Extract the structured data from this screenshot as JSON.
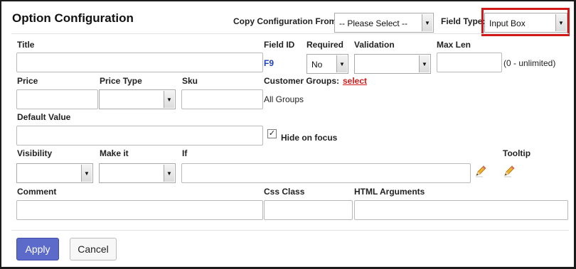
{
  "dialog": {
    "title": "Option Configuration",
    "copy_config_label": "Copy Configuration From:",
    "copy_config_value": "-- Please Select --",
    "field_type_label": "Field Type:",
    "field_type_value": "Input Box"
  },
  "labels": {
    "title": "Title",
    "field_id": "Field ID",
    "required": "Required",
    "validation": "Validation",
    "max_len": "Max Len",
    "price": "Price",
    "price_type": "Price Type",
    "sku": "Sku",
    "customer_groups": "Customer Groups:",
    "default_value": "Default Value",
    "hide_on_focus": "Hide on focus",
    "visibility": "Visibility",
    "make_it": "Make it",
    "if": "If",
    "tooltip": "Tooltip",
    "comment": "Comment",
    "css_class": "Css Class",
    "html_arguments": "HTML Arguments"
  },
  "values": {
    "field_id": "F9",
    "required": "No",
    "validation": "",
    "price_type": "",
    "visibility": "",
    "make_it": "",
    "max_len_hint": "(0 - unlimited)",
    "customer_groups_link": "select",
    "customer_groups_value": "All Groups",
    "hide_on_focus_checked": true
  },
  "buttons": {
    "apply": "Apply",
    "cancel": "Cancel"
  },
  "icons": {
    "if_edit": "pencil-icon",
    "tooltip_edit": "pencil-icon"
  },
  "colors": {
    "apply_bg": "#5c6bc9",
    "link_red": "#d21a1a",
    "field_id_blue": "#1f3fb8",
    "highlight_border": "#d21a1a"
  }
}
